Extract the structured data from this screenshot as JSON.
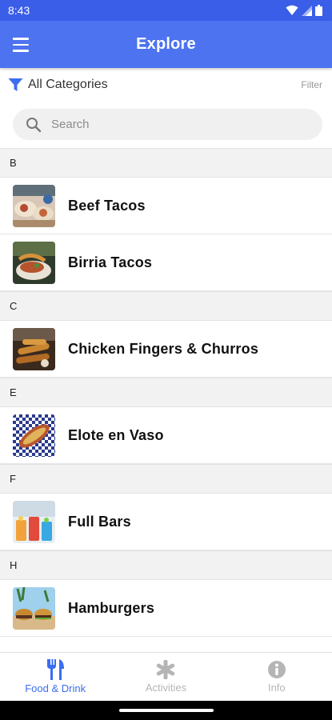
{
  "status_bar": {
    "time": "8:43"
  },
  "app_bar": {
    "title": "Explore"
  },
  "filter": {
    "category_label": "All Categories",
    "filter_link": "Filter"
  },
  "search": {
    "placeholder": "Search"
  },
  "sections": [
    {
      "letter": "B",
      "items": [
        "Beef Tacos",
        "Birria Tacos"
      ]
    },
    {
      "letter": "C",
      "items": [
        "Chicken Fingers & Churros"
      ]
    },
    {
      "letter": "E",
      "items": [
        "Elote en Vaso"
      ]
    },
    {
      "letter": "F",
      "items": [
        "Full Bars"
      ]
    },
    {
      "letter": "H",
      "items": [
        "Hamburgers"
      ]
    }
  ],
  "tabs": [
    {
      "label": "Food & Drink",
      "icon": "fork-knife-icon",
      "active": true
    },
    {
      "label": "Activities",
      "icon": "asterisk-icon",
      "active": false
    },
    {
      "label": "Info",
      "icon": "info-icon",
      "active": false
    }
  ],
  "colors": {
    "app_bar": "#4d73f0",
    "status_bar": "#3b5ee8",
    "accent": "#3b6df0",
    "inactive": "#b5b5b5"
  }
}
